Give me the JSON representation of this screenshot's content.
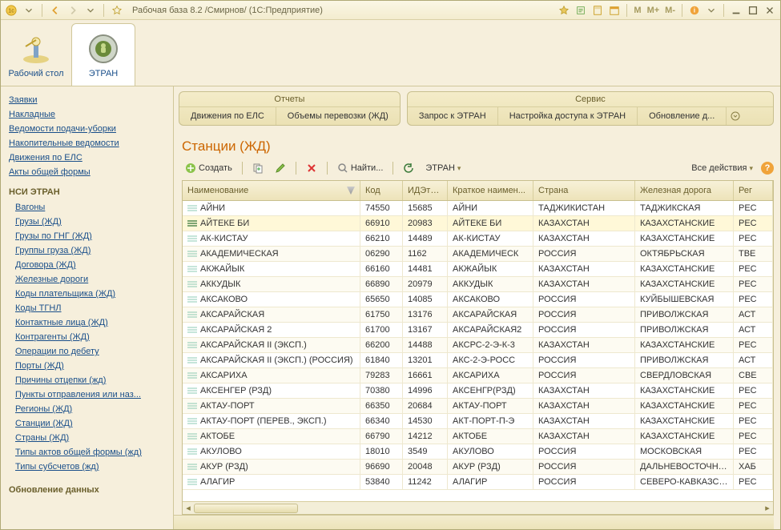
{
  "window": {
    "title": "Рабочая база 8.2 /Смирнов/  (1С:Предприятие)"
  },
  "sections": {
    "desktop": "Рабочий стол",
    "etran": "ЭТРАН"
  },
  "sidebar": {
    "top": [
      "Заявки",
      "Накладные",
      "Ведомости подачи-уборки",
      "Накопительные ведомости",
      "Движения по ЕЛС",
      "Акты общей формы"
    ],
    "group2_title": "НСИ ЭТРАН",
    "group2": [
      "Вагоны",
      "Грузы (ЖД)",
      "Грузы по ГНГ (ЖД)",
      "Группы груза (ЖД)",
      "Договора (ЖД)",
      "Железные дороги",
      "Коды плательщика (ЖД)",
      "Коды ТГНЛ",
      "Контактные лица (ЖД)",
      "Контрагенты (ЖД)",
      "Операции по дебету",
      "Порты (ЖД)",
      "Причины отцепки (жд)",
      "Пункты отправления или наз...",
      "Регионы (ЖД)",
      "Станции (ЖД)",
      "Страны (ЖД)",
      "Типы актов общей формы (жд)",
      "Типы субсчетов (жд)"
    ],
    "bottom": "Обновление данных"
  },
  "toolgroups": {
    "reports": {
      "title": "Отчеты",
      "items": [
        "Движения по ЕЛС",
        "Объемы перевозки (ЖД)"
      ]
    },
    "service": {
      "title": "Сервис",
      "items": [
        "Запрос к ЭТРАН",
        "Настройка доступа к ЭТРАН",
        "Обновление д..."
      ]
    }
  },
  "page": {
    "title": "Станции (ЖД)"
  },
  "grid_toolbar": {
    "create": "Создать",
    "find": "Найти...",
    "etran": "ЭТРАН",
    "all_actions": "Все действия"
  },
  "grid": {
    "columns": [
      "Наименование",
      "Код",
      "ИДЭтран",
      "Краткое наимен...",
      "Страна",
      "Железная дорога",
      "Рег"
    ],
    "rows": [
      [
        "АЙНИ",
        "74550",
        "15685",
        "АЙНИ",
        "ТАДЖИКИСТАН",
        "ТАДЖИКСКАЯ",
        "РЕС"
      ],
      [
        "АЙТЕКЕ БИ",
        "66910",
        "20983",
        "АЙТЕКЕ БИ",
        "КАЗАХСТАН",
        "КАЗАХСТАНСКИЕ",
        "РЕС"
      ],
      [
        "АК-КИСТАУ",
        "66210",
        "14489",
        "АК-КИСТАУ",
        "КАЗАХСТАН",
        "КАЗАХСТАНСКИЕ",
        "РЕС"
      ],
      [
        "АКАДЕМИЧЕСКАЯ",
        "06290",
        "1162",
        "АКАДЕМИЧЕСК",
        "РОССИЯ",
        "ОКТЯБРЬСКАЯ",
        "ТВЕ"
      ],
      [
        "АКЖАЙЫК",
        "66160",
        "14481",
        "АКЖАЙЫК",
        "КАЗАХСТАН",
        "КАЗАХСТАНСКИЕ",
        "РЕС"
      ],
      [
        "АККУДЫК",
        "66890",
        "20979",
        "АККУДЫК",
        "КАЗАХСТАН",
        "КАЗАХСТАНСКИЕ",
        "РЕС"
      ],
      [
        "АКСАКОВО",
        "65650",
        "14085",
        "АКСАКОВО",
        "РОССИЯ",
        "КУЙБЫШЕВСКАЯ",
        "РЕС"
      ],
      [
        "АКСАРАЙСКАЯ",
        "61750",
        "13176",
        "АКСАРАЙСКАЯ",
        "РОССИЯ",
        "ПРИВОЛЖСКАЯ",
        "АСТ"
      ],
      [
        "АКСАРАЙСКАЯ 2",
        "61700",
        "13167",
        "АКСАРАЙСКАЯ2",
        "РОССИЯ",
        "ПРИВОЛЖСКАЯ",
        "АСТ"
      ],
      [
        "АКСАРАЙСКАЯ II (ЭКСП.)",
        "66200",
        "14488",
        "АКСРС-2-Э-К-3",
        "КАЗАХСТАН",
        "КАЗАХСТАНСКИЕ",
        "РЕС"
      ],
      [
        "АКСАРАЙСКАЯ II (ЭКСП.) (РОССИЯ)",
        "61840",
        "13201",
        "АКС-2-Э-РОСС",
        "РОССИЯ",
        "ПРИВОЛЖСКАЯ",
        "АСТ"
      ],
      [
        "АКСАРИХА",
        "79283",
        "16661",
        "АКСАРИХА",
        "РОССИЯ",
        "СВЕРДЛОВСКАЯ",
        "СВЕ"
      ],
      [
        "АКСЕНГЕР (РЗД)",
        "70380",
        "14996",
        "АКСЕНГР(РЗД)",
        "КАЗАХСТАН",
        "КАЗАХСТАНСКИЕ",
        "РЕС"
      ],
      [
        "АКТАУ-ПОРТ",
        "66350",
        "20684",
        "АКТАУ-ПОРТ",
        "КАЗАХСТАН",
        "КАЗАХСТАНСКИЕ",
        "РЕС"
      ],
      [
        "АКТАУ-ПОРТ (ПЕРЕВ., ЭКСП.)",
        "66340",
        "14530",
        "АКТ-ПОРТ-П-Э",
        "КАЗАХСТАН",
        "КАЗАХСТАНСКИЕ",
        "РЕС"
      ],
      [
        "АКТОБЕ",
        "66790",
        "14212",
        "АКТОБЕ",
        "КАЗАХСТАН",
        "КАЗАХСТАНСКИЕ",
        "РЕС"
      ],
      [
        "АКУЛОВО",
        "18010",
        "3549",
        "АКУЛОВО",
        "РОССИЯ",
        "МОСКОВСКАЯ",
        "РЕС"
      ],
      [
        "АКУР (РЗД)",
        "96690",
        "20048",
        "АКУР (РЗД)",
        "РОССИЯ",
        "ДАЛЬНЕВОСТОЧНАЯ",
        "ХАБ"
      ],
      [
        "АЛАГИР",
        "53840",
        "11242",
        "АЛАГИР",
        "РОССИЯ",
        "СЕВЕРО-КАВКАЗСКАЯ",
        "РЕС"
      ]
    ]
  }
}
